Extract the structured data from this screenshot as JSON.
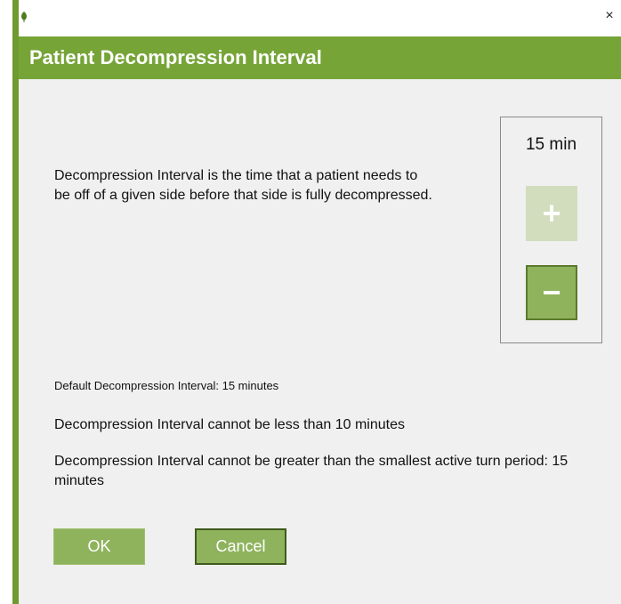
{
  "window": {
    "close_glyph": "×",
    "app_icon": "leaf-icon"
  },
  "header": {
    "title": "Patient Decompression Interval"
  },
  "main": {
    "description": "Decompression Interval is the time that a patient needs to be off of a given side before that side is fully decompressed.",
    "stepper": {
      "value": "15 min",
      "plus_glyph": "+",
      "minus_glyph": "−"
    },
    "default_info": "Default Decompression Interval: 15 minutes",
    "min_info": "Decompression Interval cannot be less than 10 minutes",
    "max_info": "Decompression Interval cannot be greater than the smallest active turn period: 15 minutes"
  },
  "buttons": {
    "ok_label": "OK",
    "cancel_label": "Cancel"
  },
  "colors": {
    "accent": "#76a437",
    "button": "#8fb35d",
    "button_disabled": "#d1ddbd"
  }
}
